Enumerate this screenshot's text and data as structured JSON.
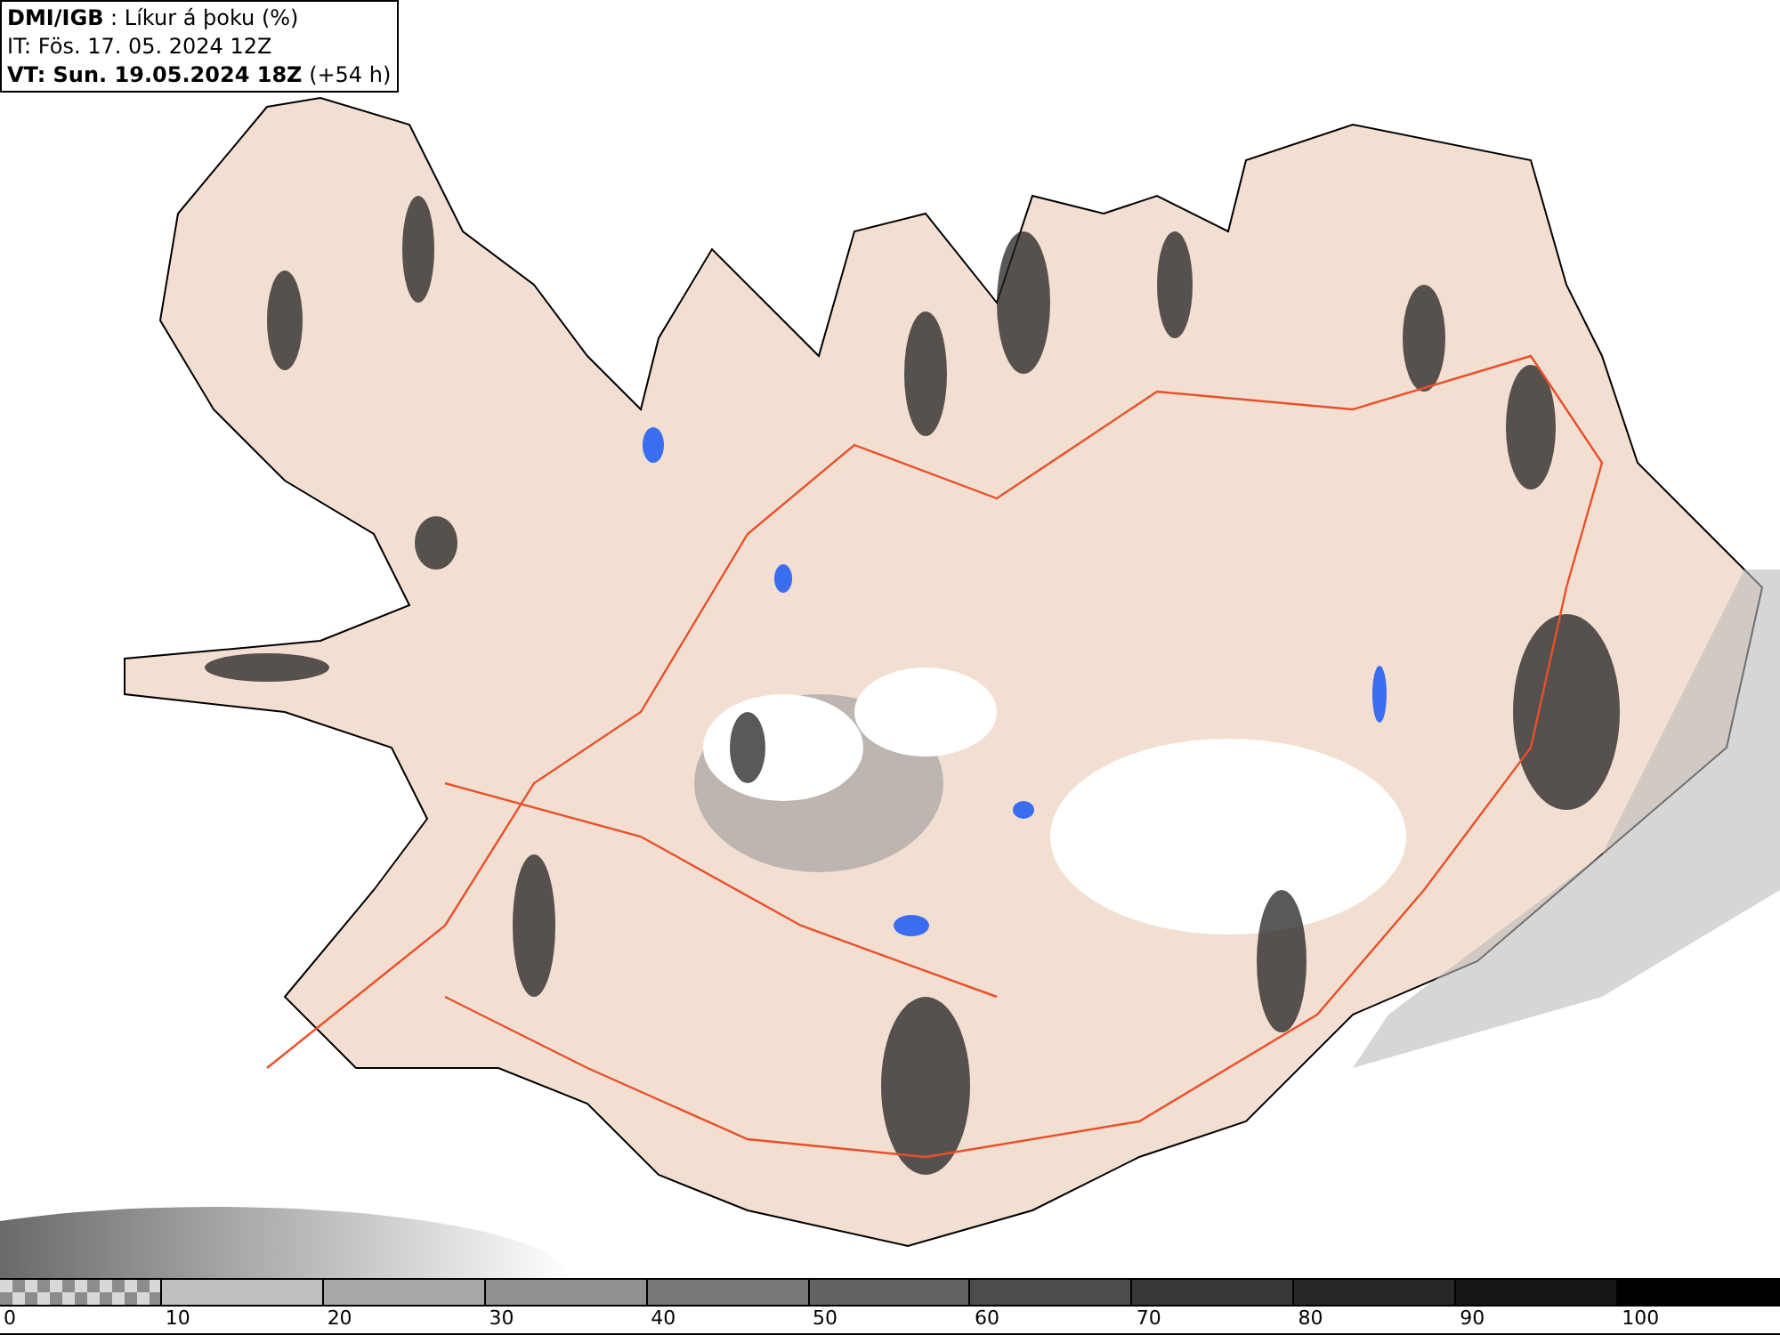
{
  "header": {
    "title": "**DMI/IGB** : Líkur á þoku (%)",
    "issue_time": "IT: Fös. 17. 05. 2024 12Z",
    "valid_time": "**VT: Sun. 19.05.2024 18Z** (+54 h)"
  },
  "legend": [
    {
      "label": "0",
      "kind": "checker",
      "color": "#8c8c8c"
    },
    {
      "label": "10",
      "kind": "solid",
      "color": "#c0c0c0"
    },
    {
      "label": "20",
      "kind": "solid",
      "color": "#a8a8a8"
    },
    {
      "label": "30",
      "kind": "solid",
      "color": "#909090"
    },
    {
      "label": "40",
      "kind": "solid",
      "color": "#787878"
    },
    {
      "label": "50",
      "kind": "solid",
      "color": "#636363"
    },
    {
      "label": "60",
      "kind": "solid",
      "color": "#4c4c4c"
    },
    {
      "label": "70",
      "kind": "solid",
      "color": "#383838"
    },
    {
      "label": "80",
      "kind": "solid",
      "color": "#262626"
    },
    {
      "label": "90",
      "kind": "solid",
      "color": "#161616"
    },
    {
      "label": "100",
      "kind": "solid",
      "color": "#000000"
    }
  ]
}
